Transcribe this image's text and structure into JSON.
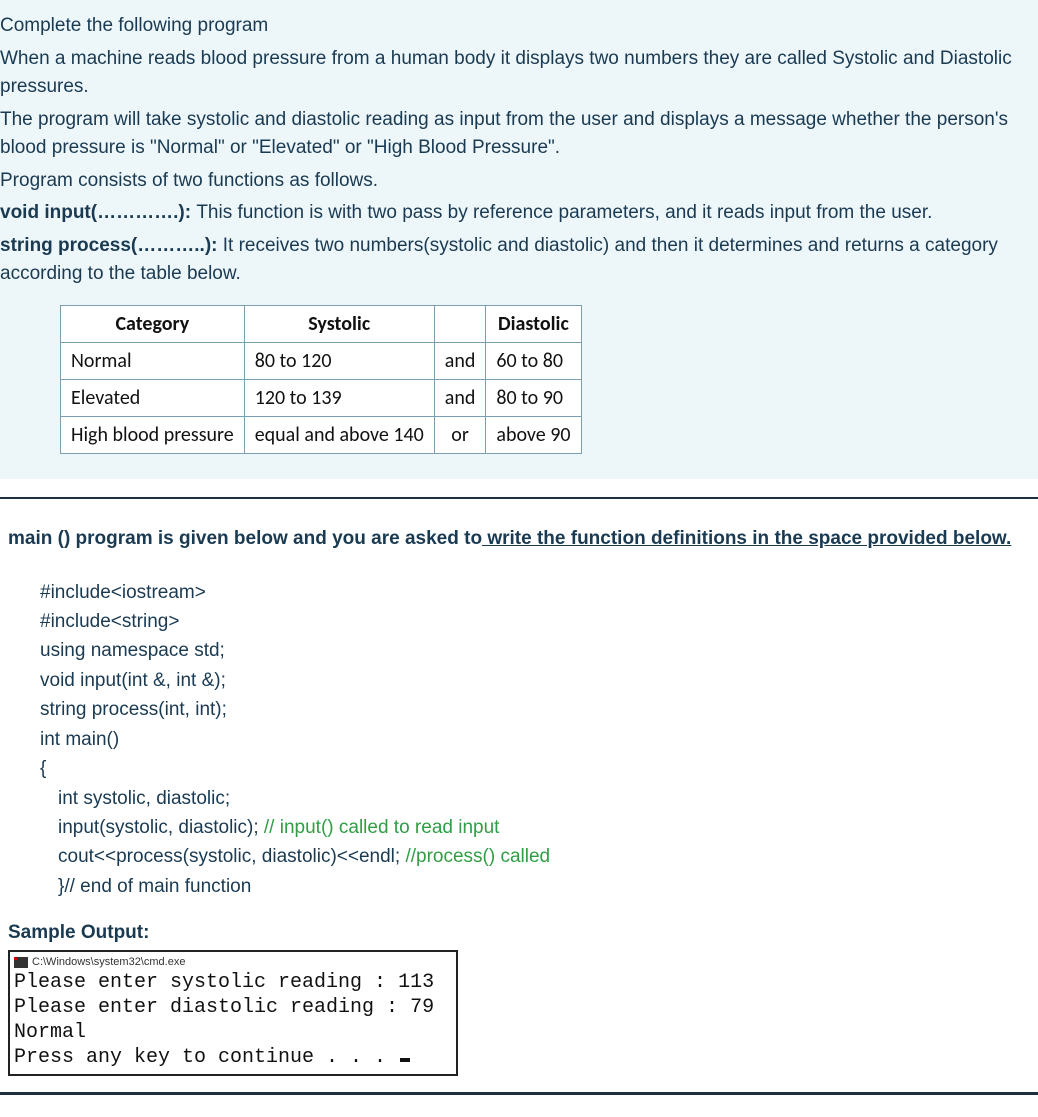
{
  "intro": {
    "heading": "Complete the following program",
    "p1": "When a machine reads blood pressure from a human body it displays two numbers they are called Systolic and Diastolic pressures.",
    "p2": "The program will take systolic and diastolic reading as input from the user and displays a message whether the person's blood pressure is \"Normal\" or \"Elevated\" or \"High Blood Pressure\".",
    "p3": "Program consists of two functions as follows.",
    "func1_name": "void input(………….): ",
    "func1_desc": "This function is with two pass by reference parameters, and it reads input from the user.",
    "func2_name": "string process(………..): ",
    "func2_desc": "It receives two numbers(systolic and diastolic) and then it determines and returns a category according to the table below."
  },
  "table": {
    "headers": [
      "Category",
      "Systolic",
      "",
      "Diastolic"
    ],
    "rows": [
      [
        "Normal",
        "80  to 120",
        "and",
        "60 to 80"
      ],
      [
        "Elevated",
        "120 to 139",
        "and",
        "80 to 90"
      ],
      [
        "High blood pressure",
        "equal and above 140",
        "or",
        "above 90"
      ]
    ]
  },
  "main_instruction": {
    "prefix": "main () program is given below and you are asked to",
    "underlined": " write the function definitions in the space provided below."
  },
  "code": {
    "l1": "#include<iostream>",
    "l2": "#include<string>",
    "l3": "using namespace std;",
    "l4": "void input(int &, int &);",
    "l5": "string process(int, int);",
    "l6": "int main()",
    "l7": "{",
    "l8": "int systolic, diastolic;",
    "l9a": "input(systolic, diastolic); ",
    "l9b": "// input() called to read input",
    "l10a": " cout<<process(systolic, diastolic)<<endl; ",
    "l10b": "//process() called",
    "l11": "}// end of main function"
  },
  "sample": {
    "heading": "Sample Output:",
    "title": "C:\\Windows\\system32\\cmd.exe",
    "line1": "Please enter systolic reading : 113",
    "line2": "Please enter diastolic reading : 79",
    "line3": "Normal",
    "line4": "Press any key to continue . . . "
  }
}
